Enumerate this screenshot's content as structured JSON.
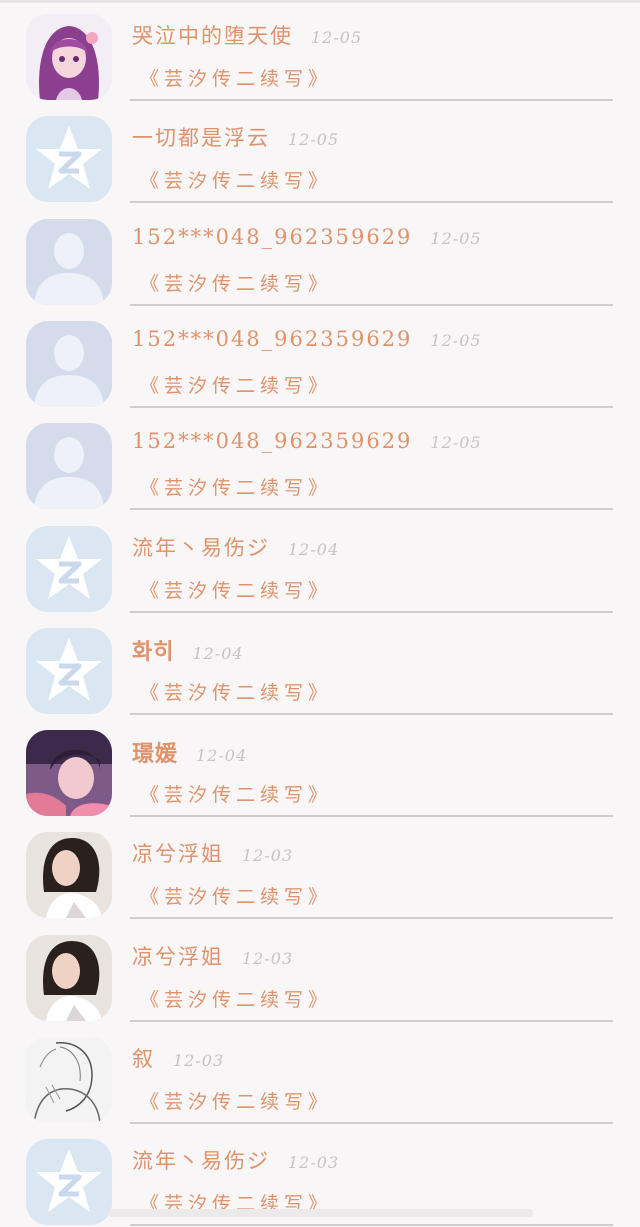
{
  "items": [
    {
      "name": "哭泣中的堕天使",
      "time": "12-05",
      "title": "《芸汐传二续写》",
      "avatar": "anime-girl-avatar",
      "bold": false
    },
    {
      "name": "一切都是浮云",
      "time": "12-05",
      "title": "《芸汐传二续写》",
      "avatar": "qq-default-avatar",
      "bold": false
    },
    {
      "name": "152***048_962359629",
      "time": "12-05",
      "title": "《芸汐传二续写》",
      "avatar": "person-silhouette-avatar",
      "bold": false
    },
    {
      "name": "152***048_962359629",
      "time": "12-05",
      "title": "《芸汐传二续写》",
      "avatar": "person-silhouette-avatar",
      "bold": false
    },
    {
      "name": "152***048_962359629",
      "time": "12-05",
      "title": "《芸汐传二续写》",
      "avatar": "person-silhouette-avatar",
      "bold": false
    },
    {
      "name": "流年丶易伤ジ",
      "time": "12-04",
      "title": "《芸汐传二续写》",
      "avatar": "qq-default-avatar",
      "bold": false
    },
    {
      "name": "화히",
      "time": "12-04",
      "title": "《芸汐传二续写》",
      "avatar": "qq-default-avatar",
      "bold": true
    },
    {
      "name": "璟媛",
      "time": "12-04",
      "title": "《芸汐传二续写》",
      "avatar": "purple-hair-girl-avatar",
      "bold": true
    },
    {
      "name": "凉兮浮姐",
      "time": "12-03",
      "title": "《芸汐传二续写》",
      "avatar": "actress-photo-avatar",
      "bold": false
    },
    {
      "name": "凉兮浮姐",
      "time": "12-03",
      "title": "《芸汐传二续写》",
      "avatar": "actress-photo-avatar",
      "bold": false
    },
    {
      "name": "叙",
      "time": "12-03",
      "title": "《芸汐传二续写》",
      "avatar": "sketch-drawing-avatar",
      "bold": false
    },
    {
      "name": "流年丶易伤ジ",
      "time": "12-03",
      "title": "《芸汐传二续写》",
      "avatar": "qq-default-avatar",
      "bold": false
    }
  ],
  "colors": {
    "accent": "#e0936b",
    "time": "#c9c2c2",
    "background": "#f8f6f6",
    "divider": "#cfcccc"
  }
}
